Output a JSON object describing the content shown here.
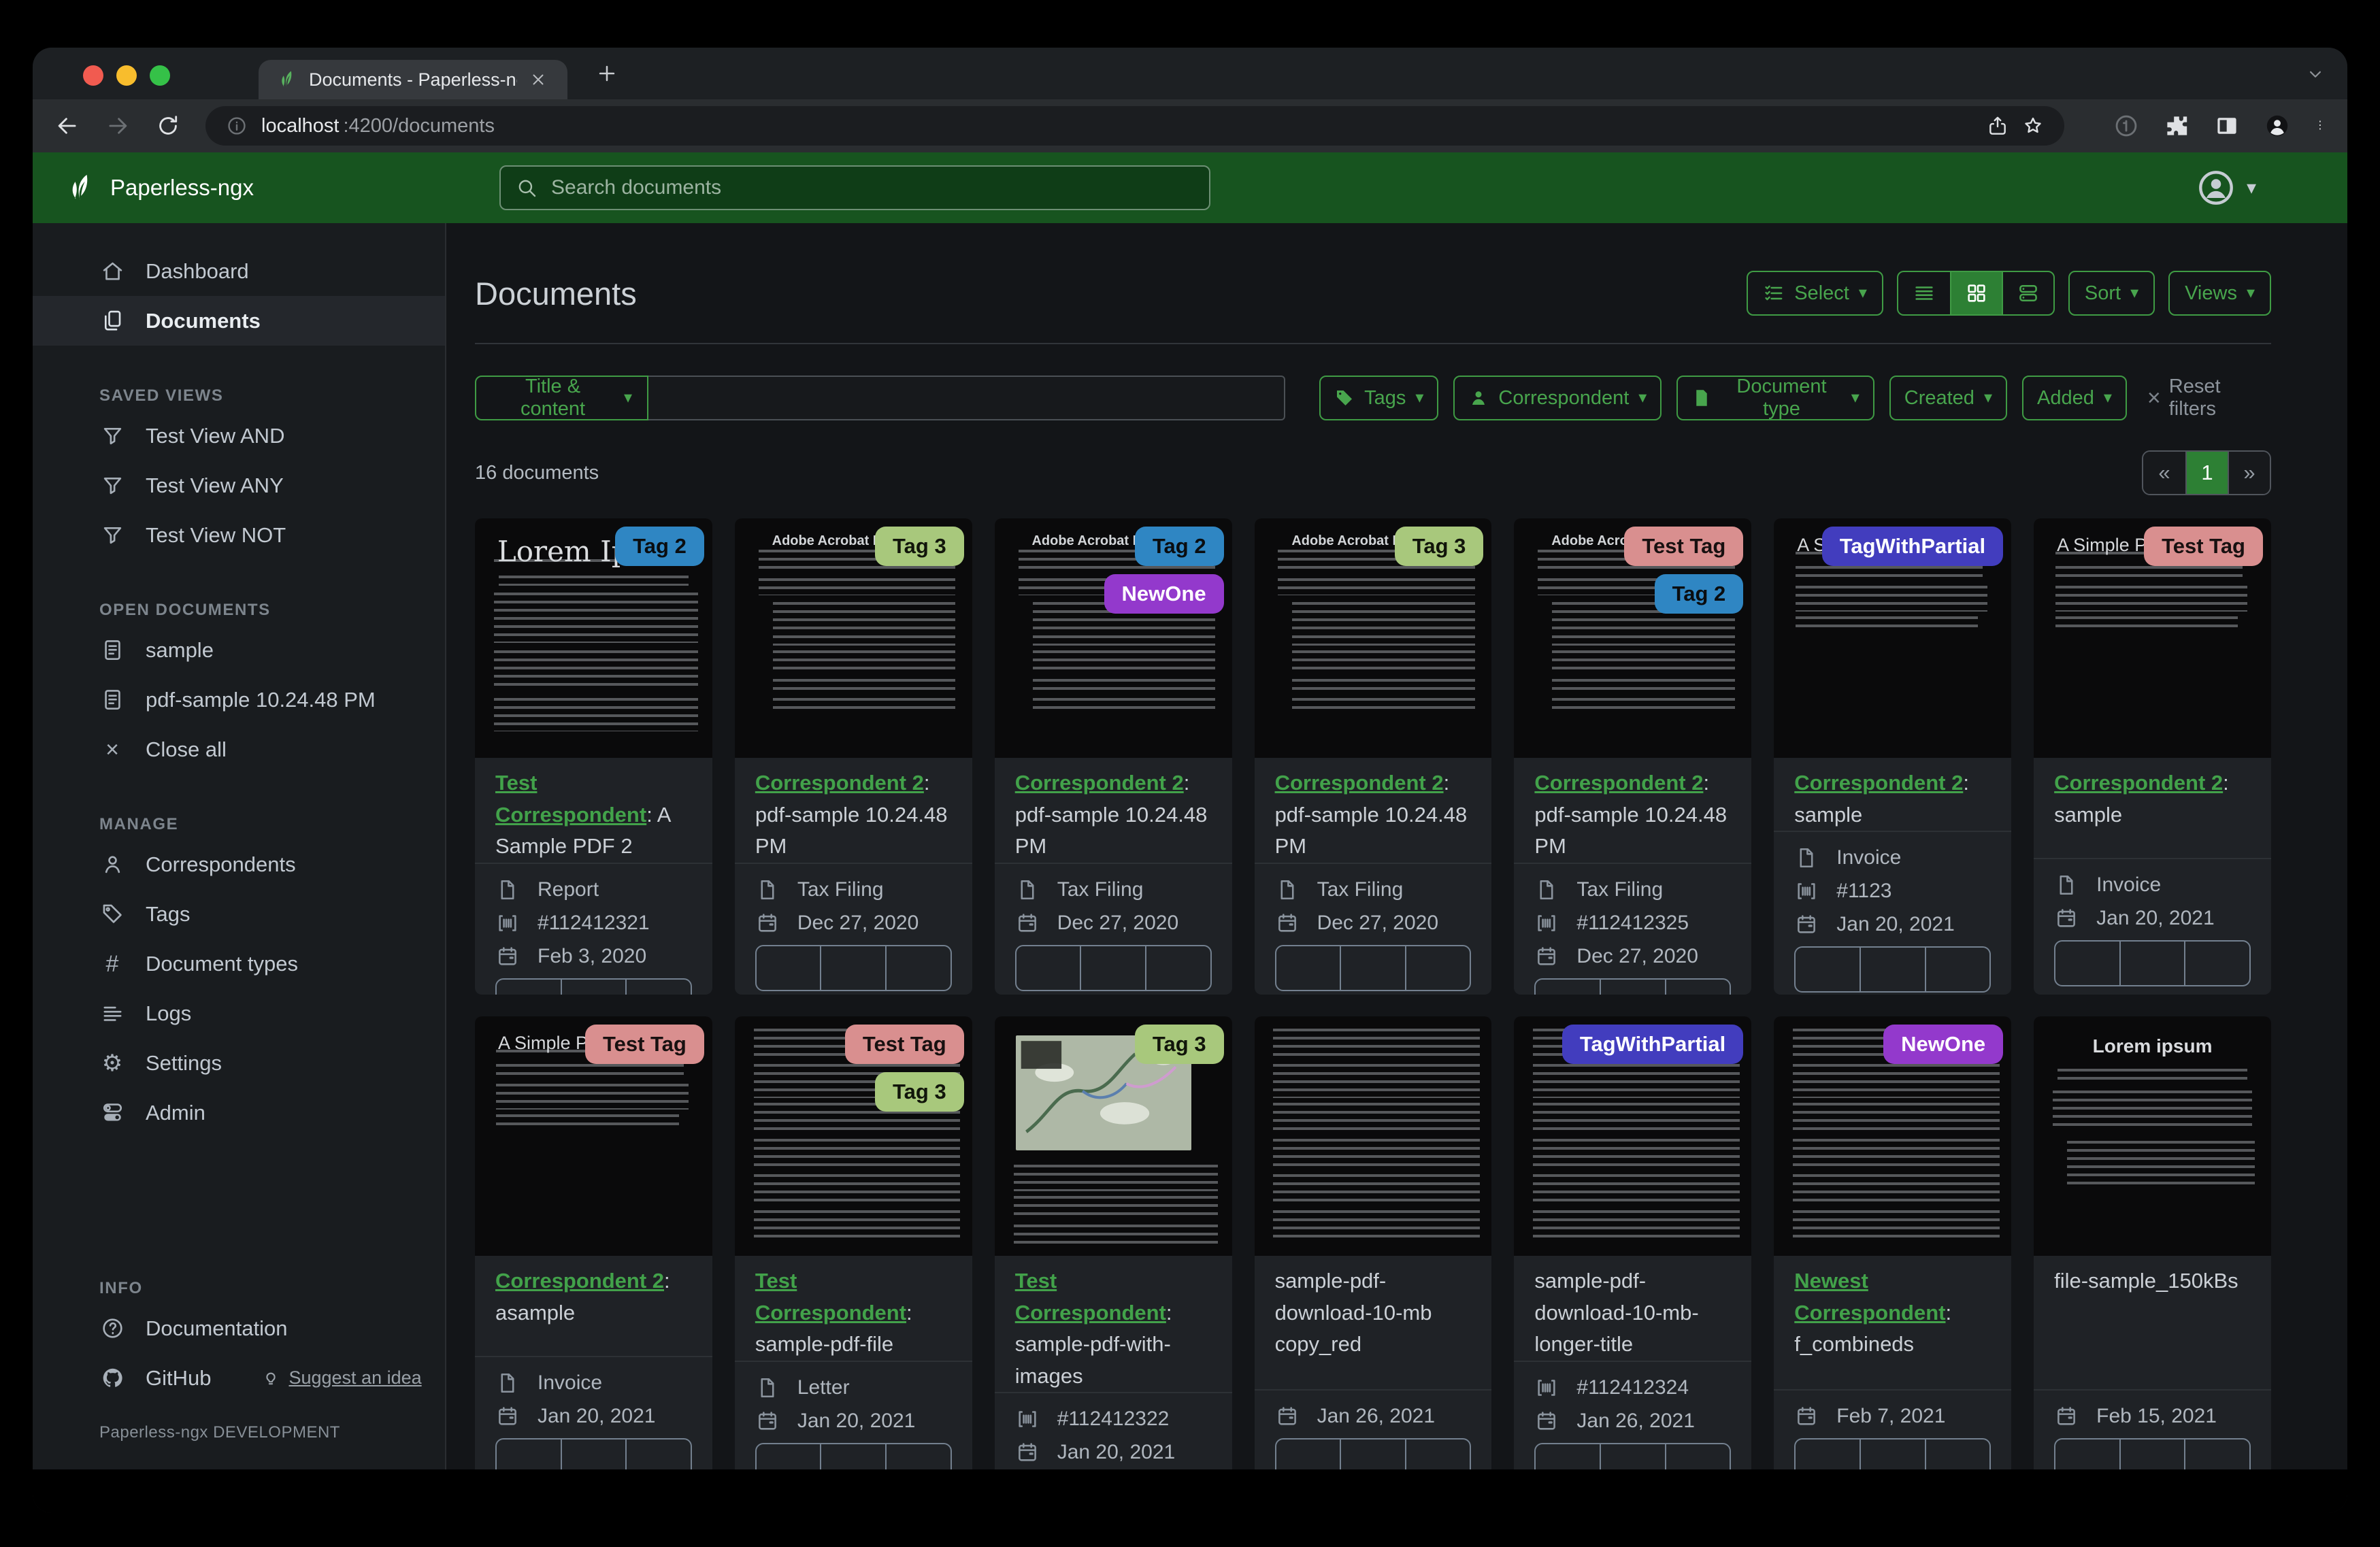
{
  "browser": {
    "tab_title": "Documents - Paperless-ngx",
    "url_host": "localhost",
    "url_rest": ":4200/documents",
    "toolbar_icons": [
      "back",
      "forward",
      "reload",
      "info",
      "share",
      "bookmark-star",
      "extension",
      "puzzle",
      "split-panel",
      "profile",
      "menu"
    ]
  },
  "navbar": {
    "brand": "Paperless-ngx",
    "search_placeholder": "Search documents"
  },
  "sidebar": {
    "primary": [
      {
        "icon": "home",
        "label": "Dashboard",
        "active": false
      },
      {
        "icon": "documents",
        "label": "Documents",
        "active": true
      }
    ],
    "sections": [
      {
        "heading": "SAVED VIEWS",
        "items": [
          {
            "icon": "funnel",
            "label": "Test View AND"
          },
          {
            "icon": "funnel",
            "label": "Test View ANY"
          },
          {
            "icon": "funnel",
            "label": "Test View NOT"
          }
        ]
      },
      {
        "heading": "OPEN DOCUMENTS",
        "items": [
          {
            "icon": "doc-text",
            "label": "sample"
          },
          {
            "icon": "doc-text",
            "label": "pdf-sample 10.24.48 PM"
          },
          {
            "icon": "close",
            "label": "Close all"
          }
        ]
      },
      {
        "heading": "MANAGE",
        "items": [
          {
            "icon": "person",
            "label": "Correspondents"
          },
          {
            "icon": "tags",
            "label": "Tags"
          },
          {
            "icon": "hash",
            "label": "Document types"
          },
          {
            "icon": "list",
            "label": "Logs"
          },
          {
            "icon": "gear",
            "label": "Settings"
          },
          {
            "icon": "toggles",
            "label": "Admin"
          }
        ]
      }
    ],
    "info_section": {
      "heading": "INFO",
      "items": [
        {
          "icon": "question",
          "label": "Documentation"
        },
        {
          "icon": "github",
          "label": "GitHub",
          "suffix": {
            "icon": "bulb",
            "label": "Suggest an idea"
          }
        }
      ]
    },
    "footer": "Paperless-ngx DEVELOPMENT"
  },
  "main": {
    "title": "Documents",
    "select_label": "Select",
    "sort_label": "Sort",
    "views_label": "Views",
    "filter_field": "Title & content",
    "filter_buttons": [
      {
        "icon": "tag-fill",
        "label": "Tags"
      },
      {
        "icon": "person-fill",
        "label": "Correspondent"
      },
      {
        "icon": "file-fill",
        "label": "Document type"
      },
      {
        "icon": null,
        "label": "Created"
      },
      {
        "icon": null,
        "label": "Added"
      }
    ],
    "reset_label": "Reset filters",
    "count": "16 documents",
    "pagination": {
      "prev": "«",
      "current": "1",
      "next": "»"
    }
  },
  "colors": {
    "navbar_green": "#17541f",
    "accent_green": "#3f9b44",
    "active_green": "#2d8034",
    "correspondent_link_green": "#42a24a"
  },
  "tag_styles": {
    "Tag 2": {
      "bg": "#2f86c3",
      "fg": "#0a0d10"
    },
    "Tag 3": {
      "bg": "#a8c87c",
      "fg": "#11150a"
    },
    "Test Tag": {
      "bg": "#d98f8f",
      "fg": "#181010"
    },
    "NewOne": {
      "bg": "#9339cc",
      "fg": "#ffffff"
    },
    "TagWithPartial": {
      "bg": "#423dbe",
      "fg": "#ffffff"
    }
  },
  "cards": [
    {
      "tags": [
        "Tag 2"
      ],
      "thumb": "lorem-title",
      "thumb_heading": "Lorem Ipsum",
      "correspondent": "Test Correspondent",
      "title_rest": ": A Sample PDF 2",
      "doc_type": "Report",
      "asn": "#112412321",
      "created": "Feb 3, 2020"
    },
    {
      "tags": [
        "Tag 3"
      ],
      "thumb": "acrobat",
      "thumb_heading": "Adobe Acrobat PDF Files",
      "correspondent": "Correspondent 2",
      "title_rest": ": pdf-sample 10.24.48 PM",
      "doc_type": "Tax Filing",
      "asn": null,
      "created": "Dec 27, 2020"
    },
    {
      "tags": [
        "Tag 2",
        "NewOne"
      ],
      "thumb": "acrobat",
      "thumb_heading": "Adobe Acrobat PDF Files",
      "correspondent": "Correspondent 2",
      "title_rest": ": pdf-sample 10.24.48 PM",
      "doc_type": "Tax Filing",
      "asn": null,
      "created": "Dec 27, 2020"
    },
    {
      "tags": [
        "Tag 3"
      ],
      "thumb": "acrobat",
      "thumb_heading": "Adobe Acrobat PDF Files",
      "correspondent": "Correspondent 2",
      "title_rest": ": pdf-sample 10.24.48 PM",
      "doc_type": "Tax Filing",
      "asn": null,
      "created": "Dec 27, 2020"
    },
    {
      "tags": [
        "Test Tag",
        "Tag 2"
      ],
      "thumb": "acrobat",
      "thumb_heading": "Adobe Acrobat PDF Files",
      "correspondent": "Correspondent 2",
      "title_rest": ": pdf-sample 10.24.48 PM",
      "doc_type": "Tax Filing",
      "asn": "#112412325",
      "created": "Dec 27, 2020"
    },
    {
      "tags": [
        "TagWithPartial"
      ],
      "thumb": "simple",
      "thumb_heading": "A Simple PDF File",
      "correspondent": "Correspondent 2",
      "title_rest": ": sample",
      "doc_type": "Invoice",
      "asn": "#1123",
      "created": "Jan 20, 2021"
    },
    {
      "tags": [
        "Test Tag"
      ],
      "thumb": "simple",
      "thumb_heading": "A Simple PDF File",
      "correspondent": "Correspondent 2",
      "title_rest": ": sample",
      "doc_type": "Invoice",
      "asn": null,
      "created": "Jan 20, 2021"
    },
    {
      "tags": [
        "Test Tag"
      ],
      "thumb": "simple",
      "thumb_heading": "A Simple PDF File",
      "correspondent": "Correspondent 2",
      "title_rest": ": asample",
      "doc_type": "Invoice",
      "asn": null,
      "created": "Jan 20, 2021"
    },
    {
      "tags": [
        "Test Tag",
        "Tag 3"
      ],
      "thumb": "dense",
      "thumb_heading": "",
      "correspondent": "Test Correspondent",
      "title_rest": ": sample-pdf-file",
      "doc_type": "Letter",
      "asn": null,
      "created": "Jan 20, 2021"
    },
    {
      "tags": [
        "Tag 3"
      ],
      "thumb": "map",
      "thumb_heading": "",
      "correspondent": "Test Correspondent",
      "title_rest": ": sample-pdf-with-images",
      "doc_type": null,
      "asn": "#112412322",
      "created": "Jan 20, 2021"
    },
    {
      "tags": [],
      "thumb": "dense",
      "thumb_heading": "",
      "correspondent": null,
      "title": "sample-pdf-download-10-mb copy_red",
      "doc_type": null,
      "asn": null,
      "created": "Jan 26, 2021"
    },
    {
      "tags": [
        "TagWithPartial"
      ],
      "thumb": "dense",
      "thumb_heading": "",
      "correspondent": null,
      "title": "sample-pdf-download-10-mb-longer-title",
      "doc_type": null,
      "asn": "#112412324",
      "created": "Jan 26, 2021"
    },
    {
      "tags": [
        "NewOne"
      ],
      "thumb": "dense",
      "thumb_heading": "",
      "correspondent": "Newest Correspondent",
      "title_rest": ": f_combineds",
      "doc_type": null,
      "asn": null,
      "created": "Feb 7, 2021"
    },
    {
      "tags": [],
      "thumb": "lorem-bold",
      "thumb_heading": "Lorem ipsum",
      "correspondent": null,
      "title": "file-sample_150kBs",
      "doc_type": null,
      "asn": null,
      "created": "Feb 15, 2021"
    }
  ]
}
